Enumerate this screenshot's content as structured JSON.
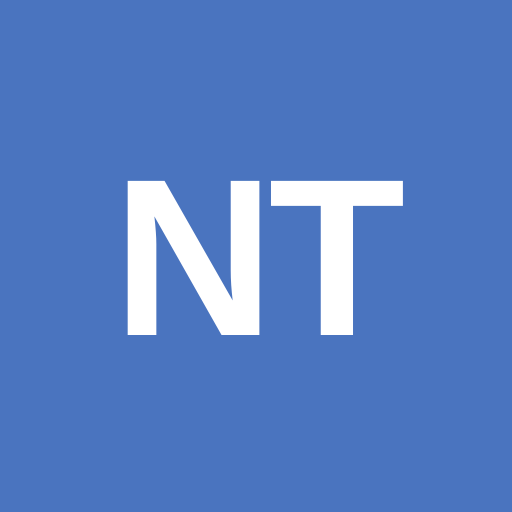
{
  "avatar": {
    "initials": "NT",
    "background_color": "#4a74bf",
    "text_color": "#ffffff"
  }
}
